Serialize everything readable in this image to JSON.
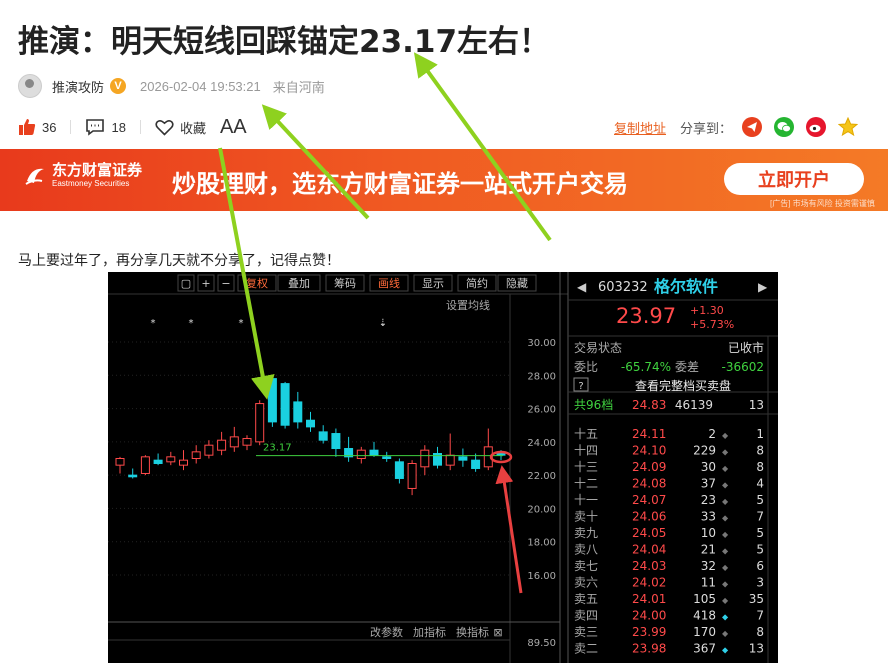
{
  "article": {
    "title": "推演：明天短线回踩锚定23.17左右！",
    "author": "推演攻防",
    "verified_badge": "V",
    "timestamp": "2026-02-04 19:53:21",
    "location": "来自河南",
    "likes": "36",
    "comments": "18",
    "favorite_label": "收藏",
    "font_size_label": "AA",
    "copy_link_label": "复制地址",
    "share_label": "分享到：",
    "share_icons": [
      "telegram-icon",
      "wechat-icon",
      "weibo-icon",
      "star-icon"
    ],
    "body_text": "马上要过年了，再分享几天就不分享了，记得点赞！"
  },
  "banner": {
    "brand_cn": "东方财富证券",
    "brand_en": "Eastmoney Securities",
    "slogan": "炒股理财，选东方财富证券一站式开户交易",
    "button": "立即开户",
    "ad_note": "[广告] 市场有风险 投资需谨慎",
    "colors": {
      "start": "#e83a1c",
      "end": "#f47a26"
    }
  },
  "terminal": {
    "toolbar": {
      "buttons": [
        "▢",
        "+",
        "−",
        "复权",
        "叠加",
        "筹码",
        "画线",
        "显示",
        "简约",
        "隐藏"
      ],
      "settings_label": "设置均线"
    },
    "chart_data": {
      "type": "candlestick",
      "y_ticks": [
        "30.00",
        "28.00",
        "26.00",
        "24.00",
        "22.00",
        "20.00",
        "18.00",
        "16.00"
      ],
      "ylim": [
        15.0,
        31.0
      ],
      "reference_line": {
        "value": 23.17,
        "label": "23.17"
      },
      "candles": [
        {
          "o": 22.6,
          "h": 23.1,
          "l": 22.1,
          "c": 23.0
        },
        {
          "o": 22.0,
          "h": 22.4,
          "l": 21.8,
          "c": 21.9
        },
        {
          "o": 22.1,
          "h": 23.2,
          "l": 22.0,
          "c": 23.1
        },
        {
          "o": 22.9,
          "h": 23.3,
          "l": 22.6,
          "c": 22.7
        },
        {
          "o": 22.8,
          "h": 23.4,
          "l": 22.6,
          "c": 23.1
        },
        {
          "o": 22.6,
          "h": 23.5,
          "l": 22.3,
          "c": 22.9
        },
        {
          "o": 23.0,
          "h": 23.8,
          "l": 22.7,
          "c": 23.4
        },
        {
          "o": 23.2,
          "h": 24.1,
          "l": 23.0,
          "c": 23.8
        },
        {
          "o": 23.5,
          "h": 24.6,
          "l": 23.2,
          "c": 24.1
        },
        {
          "o": 23.7,
          "h": 24.9,
          "l": 23.4,
          "c": 24.3
        },
        {
          "o": 23.8,
          "h": 24.4,
          "l": 23.5,
          "c": 24.2
        },
        {
          "o": 24.0,
          "h": 26.5,
          "l": 23.8,
          "c": 26.3
        },
        {
          "o": 27.8,
          "h": 28.0,
          "l": 24.9,
          "c": 25.2
        },
        {
          "o": 27.5,
          "h": 27.6,
          "l": 24.8,
          "c": 25.0
        },
        {
          "o": 26.4,
          "h": 27.0,
          "l": 24.8,
          "c": 25.2
        },
        {
          "o": 25.3,
          "h": 25.8,
          "l": 24.6,
          "c": 24.9
        },
        {
          "o": 24.6,
          "h": 25.0,
          "l": 23.9,
          "c": 24.1
        },
        {
          "o": 24.5,
          "h": 24.8,
          "l": 23.1,
          "c": 23.6
        },
        {
          "o": 23.6,
          "h": 24.3,
          "l": 22.8,
          "c": 23.1
        },
        {
          "o": 23.0,
          "h": 23.7,
          "l": 22.7,
          "c": 23.5
        },
        {
          "o": 23.5,
          "h": 24.0,
          "l": 23.1,
          "c": 23.2
        },
        {
          "o": 23.1,
          "h": 23.4,
          "l": 22.8,
          "c": 23.0
        },
        {
          "o": 22.8,
          "h": 23.0,
          "l": 21.5,
          "c": 21.8
        },
        {
          "o": 21.2,
          "h": 22.9,
          "l": 20.8,
          "c": 22.7
        },
        {
          "o": 22.5,
          "h": 23.8,
          "l": 22.0,
          "c": 23.5
        },
        {
          "o": 23.3,
          "h": 23.7,
          "l": 22.4,
          "c": 22.6
        },
        {
          "o": 22.6,
          "h": 24.5,
          "l": 22.3,
          "c": 23.2
        },
        {
          "o": 23.1,
          "h": 23.6,
          "l": 22.5,
          "c": 22.9
        },
        {
          "o": 22.9,
          "h": 23.3,
          "l": 22.2,
          "c": 22.4
        },
        {
          "o": 22.5,
          "h": 24.8,
          "l": 22.3,
          "c": 23.7
        },
        {
          "o": 23.3,
          "h": 23.5,
          "l": 22.9,
          "c": 23.2
        }
      ],
      "bottom_buttons": [
        "改参数",
        "加指标",
        "换指标"
      ],
      "lower_axis_value": "89.50"
    },
    "quote": {
      "code": "603232",
      "name": "格尔软件",
      "price": "23.97",
      "change": "+1.30",
      "change_pct": "+5.73%",
      "status_label": "交易状态",
      "status_value": "已收市",
      "ratio_label": "委比",
      "ratio_value": "-65.74%",
      "diff_label": "委差",
      "diff_value": "-36602",
      "full_book_label": "查看完整档买卖盘",
      "summary_row": {
        "level": "共96档",
        "price": "24.83",
        "qty": "46139",
        "count": "13"
      },
      "sell_levels": [
        {
          "level": "十五",
          "price": "24.11",
          "qty": "2",
          "count": "1"
        },
        {
          "level": "十四",
          "price": "24.10",
          "qty": "229",
          "count": "8"
        },
        {
          "level": "十三",
          "price": "24.09",
          "qty": "30",
          "count": "8"
        },
        {
          "level": "十二",
          "price": "24.08",
          "qty": "37",
          "count": "4"
        },
        {
          "level": "十一",
          "price": "24.07",
          "qty": "23",
          "count": "5"
        },
        {
          "level": "卖十",
          "price": "24.06",
          "qty": "33",
          "count": "7"
        },
        {
          "level": "卖九",
          "price": "24.05",
          "qty": "10",
          "count": "5"
        },
        {
          "level": "卖八",
          "price": "24.04",
          "qty": "21",
          "count": "5"
        },
        {
          "level": "卖七",
          "price": "24.03",
          "qty": "32",
          "count": "6"
        },
        {
          "level": "卖六",
          "price": "24.02",
          "qty": "11",
          "count": "3"
        },
        {
          "level": "卖五",
          "price": "24.01",
          "qty": "105",
          "count": "35"
        },
        {
          "level": "卖四",
          "price": "24.00",
          "qty": "418",
          "count": "7"
        },
        {
          "level": "卖三",
          "price": "23.99",
          "qty": "170",
          "count": "8"
        },
        {
          "level": "卖二",
          "price": "23.98",
          "qty": "367",
          "count": "13"
        }
      ]
    }
  }
}
